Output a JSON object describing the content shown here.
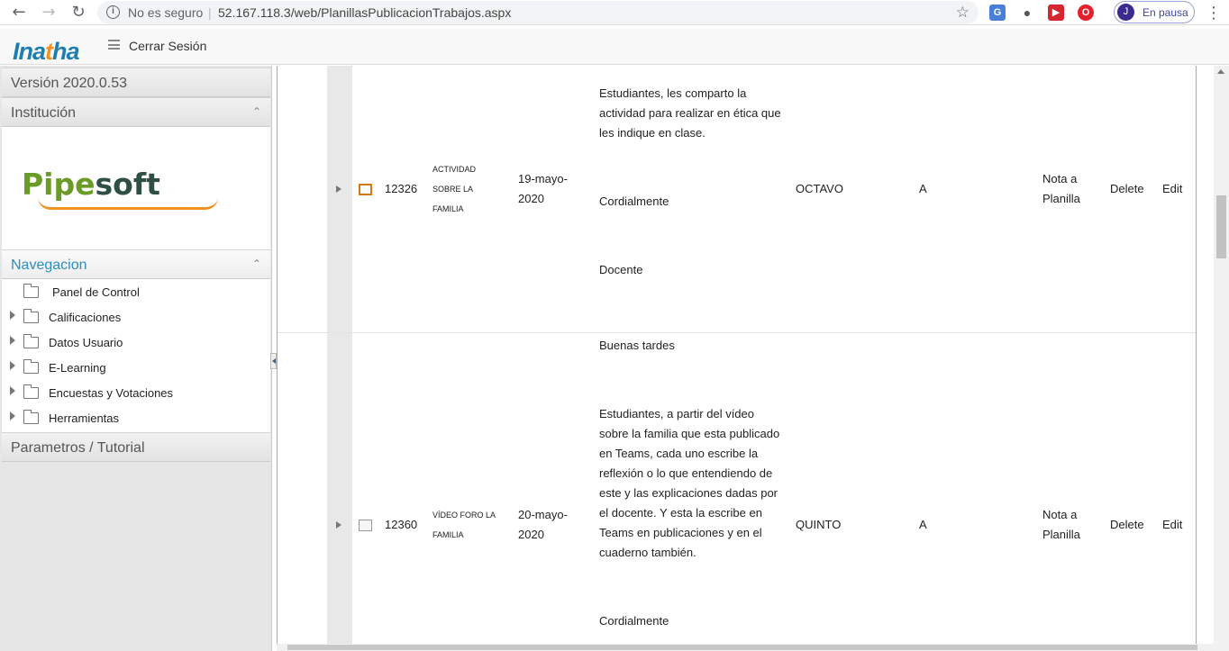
{
  "browser": {
    "insecure_label": "No es seguro",
    "separator": "|",
    "url": "52.167.118.3/web/PlanillasPublicacionTrabajos.aspx",
    "profile_initial": "J",
    "profile_status": "En pausa",
    "icons": [
      "back-icon",
      "forward-icon",
      "reload-icon",
      "info-icon",
      "star-icon",
      "translate-icon",
      "lightbulb-icon",
      "extension-icon",
      "opera-icon",
      "menu-dots-icon"
    ]
  },
  "app": {
    "logo_prefix": "Ina",
    "logo_h": "t",
    "logo_suffix": "ha",
    "logout_label": "Cerrar Sesión"
  },
  "sidebar": {
    "version": "Versión 2020.0.53",
    "institution_label": "Institución",
    "institution_logo_a": "Pipe",
    "institution_logo_b": "soft",
    "nav_label": "Navegacion",
    "items": [
      {
        "label": "Panel de Control",
        "expandable": false
      },
      {
        "label": "Calificaciones",
        "expandable": true
      },
      {
        "label": "Datos Usuario",
        "expandable": true
      },
      {
        "label": "E-Learning",
        "expandable": true
      },
      {
        "label": "Encuestas y Votaciones",
        "expandable": true
      },
      {
        "label": "Herramientas",
        "expandable": true
      }
    ],
    "params_label": "Parametros / Tutorial",
    "colors": {
      "nav_accent": "#2a8fc0",
      "header_text": "#555555"
    }
  },
  "grid": {
    "rows": [
      {
        "id": "12326",
        "title_lines": [
          "ACTIVIDAD",
          "SOBRE LA",
          "FAMILIA"
        ],
        "date_lines": [
          "19-mayo-",
          "2020"
        ],
        "desc_p1": [
          "Estudiantes, les comparto la",
          "actividad para realizar en ética que",
          "les indique en clase."
        ],
        "desc_p2": "Cordialmente",
        "desc_p3": "Docente",
        "grade": "OCTAVO",
        "group": "A",
        "note_lines": [
          "Nota a",
          "Planilla"
        ],
        "delete_label": "Delete",
        "edit_label": "Edit"
      },
      {
        "id": "12360",
        "title_lines": [
          "VÍDEO FORO LA",
          "FAMILIA"
        ],
        "date_lines": [
          "20-mayo-",
          "2020"
        ],
        "desc_p0": "Buenas tardes",
        "desc_p1": [
          "Estudiantes, a partir del vídeo",
          "sobre la familia que esta publicado",
          "en Teams, cada uno escribe la",
          "reflexión o lo que entendiendo de",
          "este y las explicaciones dadas por",
          "el docente. Y esta la escribe en",
          "Teams en publicaciones y en el",
          "cuaderno también."
        ],
        "desc_p2": "Cordialmente",
        "grade": "QUINTO",
        "group": "A",
        "note_lines": [
          "Nota a",
          "Planilla"
        ],
        "delete_label": "Delete",
        "edit_label": "Edit"
      }
    ]
  }
}
